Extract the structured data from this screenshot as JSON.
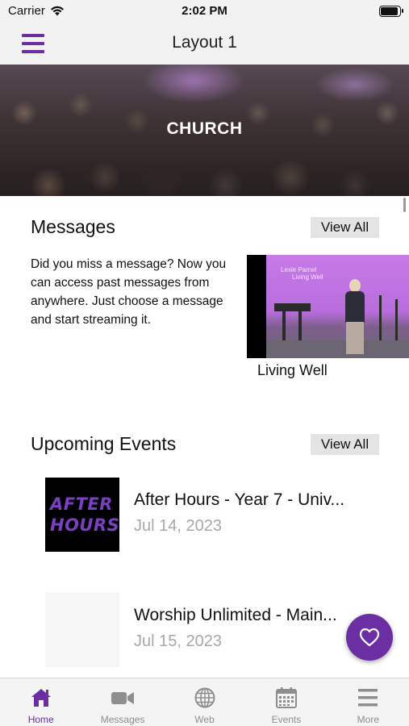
{
  "status_bar": {
    "carrier": "Carrier",
    "time": "2:02 PM",
    "battery_level": 0.95
  },
  "nav": {
    "title": "Layout 1",
    "menu_icon": "hamburger-menu-icon"
  },
  "hero": {
    "title": "CHURCH"
  },
  "messages": {
    "heading": "Messages",
    "view_all": "View All",
    "description": "Did you miss a message? Now you can access past messages from anywhere. Just choose a message and start streaming it.",
    "items": [
      {
        "title": "Living Well",
        "thumbnail_caption_line1": "Lexie Parnel",
        "thumbnail_caption_line2": "Living Well"
      }
    ]
  },
  "events": {
    "heading": "Upcoming Events",
    "view_all": "View All",
    "items": [
      {
        "title": "After Hours - Year 7 - Univ...",
        "date": "Jul 14, 2023",
        "image_text_line1": "AFTER",
        "image_text_line2": "HOURS"
      },
      {
        "title": "Worship Unlimited - Main...",
        "date": "Jul 15, 2023"
      }
    ]
  },
  "fab": {
    "icon": "heart-icon"
  },
  "tab_bar": {
    "items": [
      {
        "label": "Home",
        "icon": "home-icon",
        "active": true
      },
      {
        "label": "Messages",
        "icon": "video-camera-icon",
        "active": false
      },
      {
        "label": "Web",
        "icon": "globe-icon",
        "active": false
      },
      {
        "label": "Events",
        "icon": "calendar-icon",
        "active": false
      },
      {
        "label": "More",
        "icon": "more-lines-icon",
        "active": false
      }
    ]
  },
  "colors": {
    "accent": "#6b2fa3",
    "bar_background": "#f2f2f2",
    "inactive_tab": "#8e8e8e",
    "date_gray": "#a8a8a8"
  }
}
